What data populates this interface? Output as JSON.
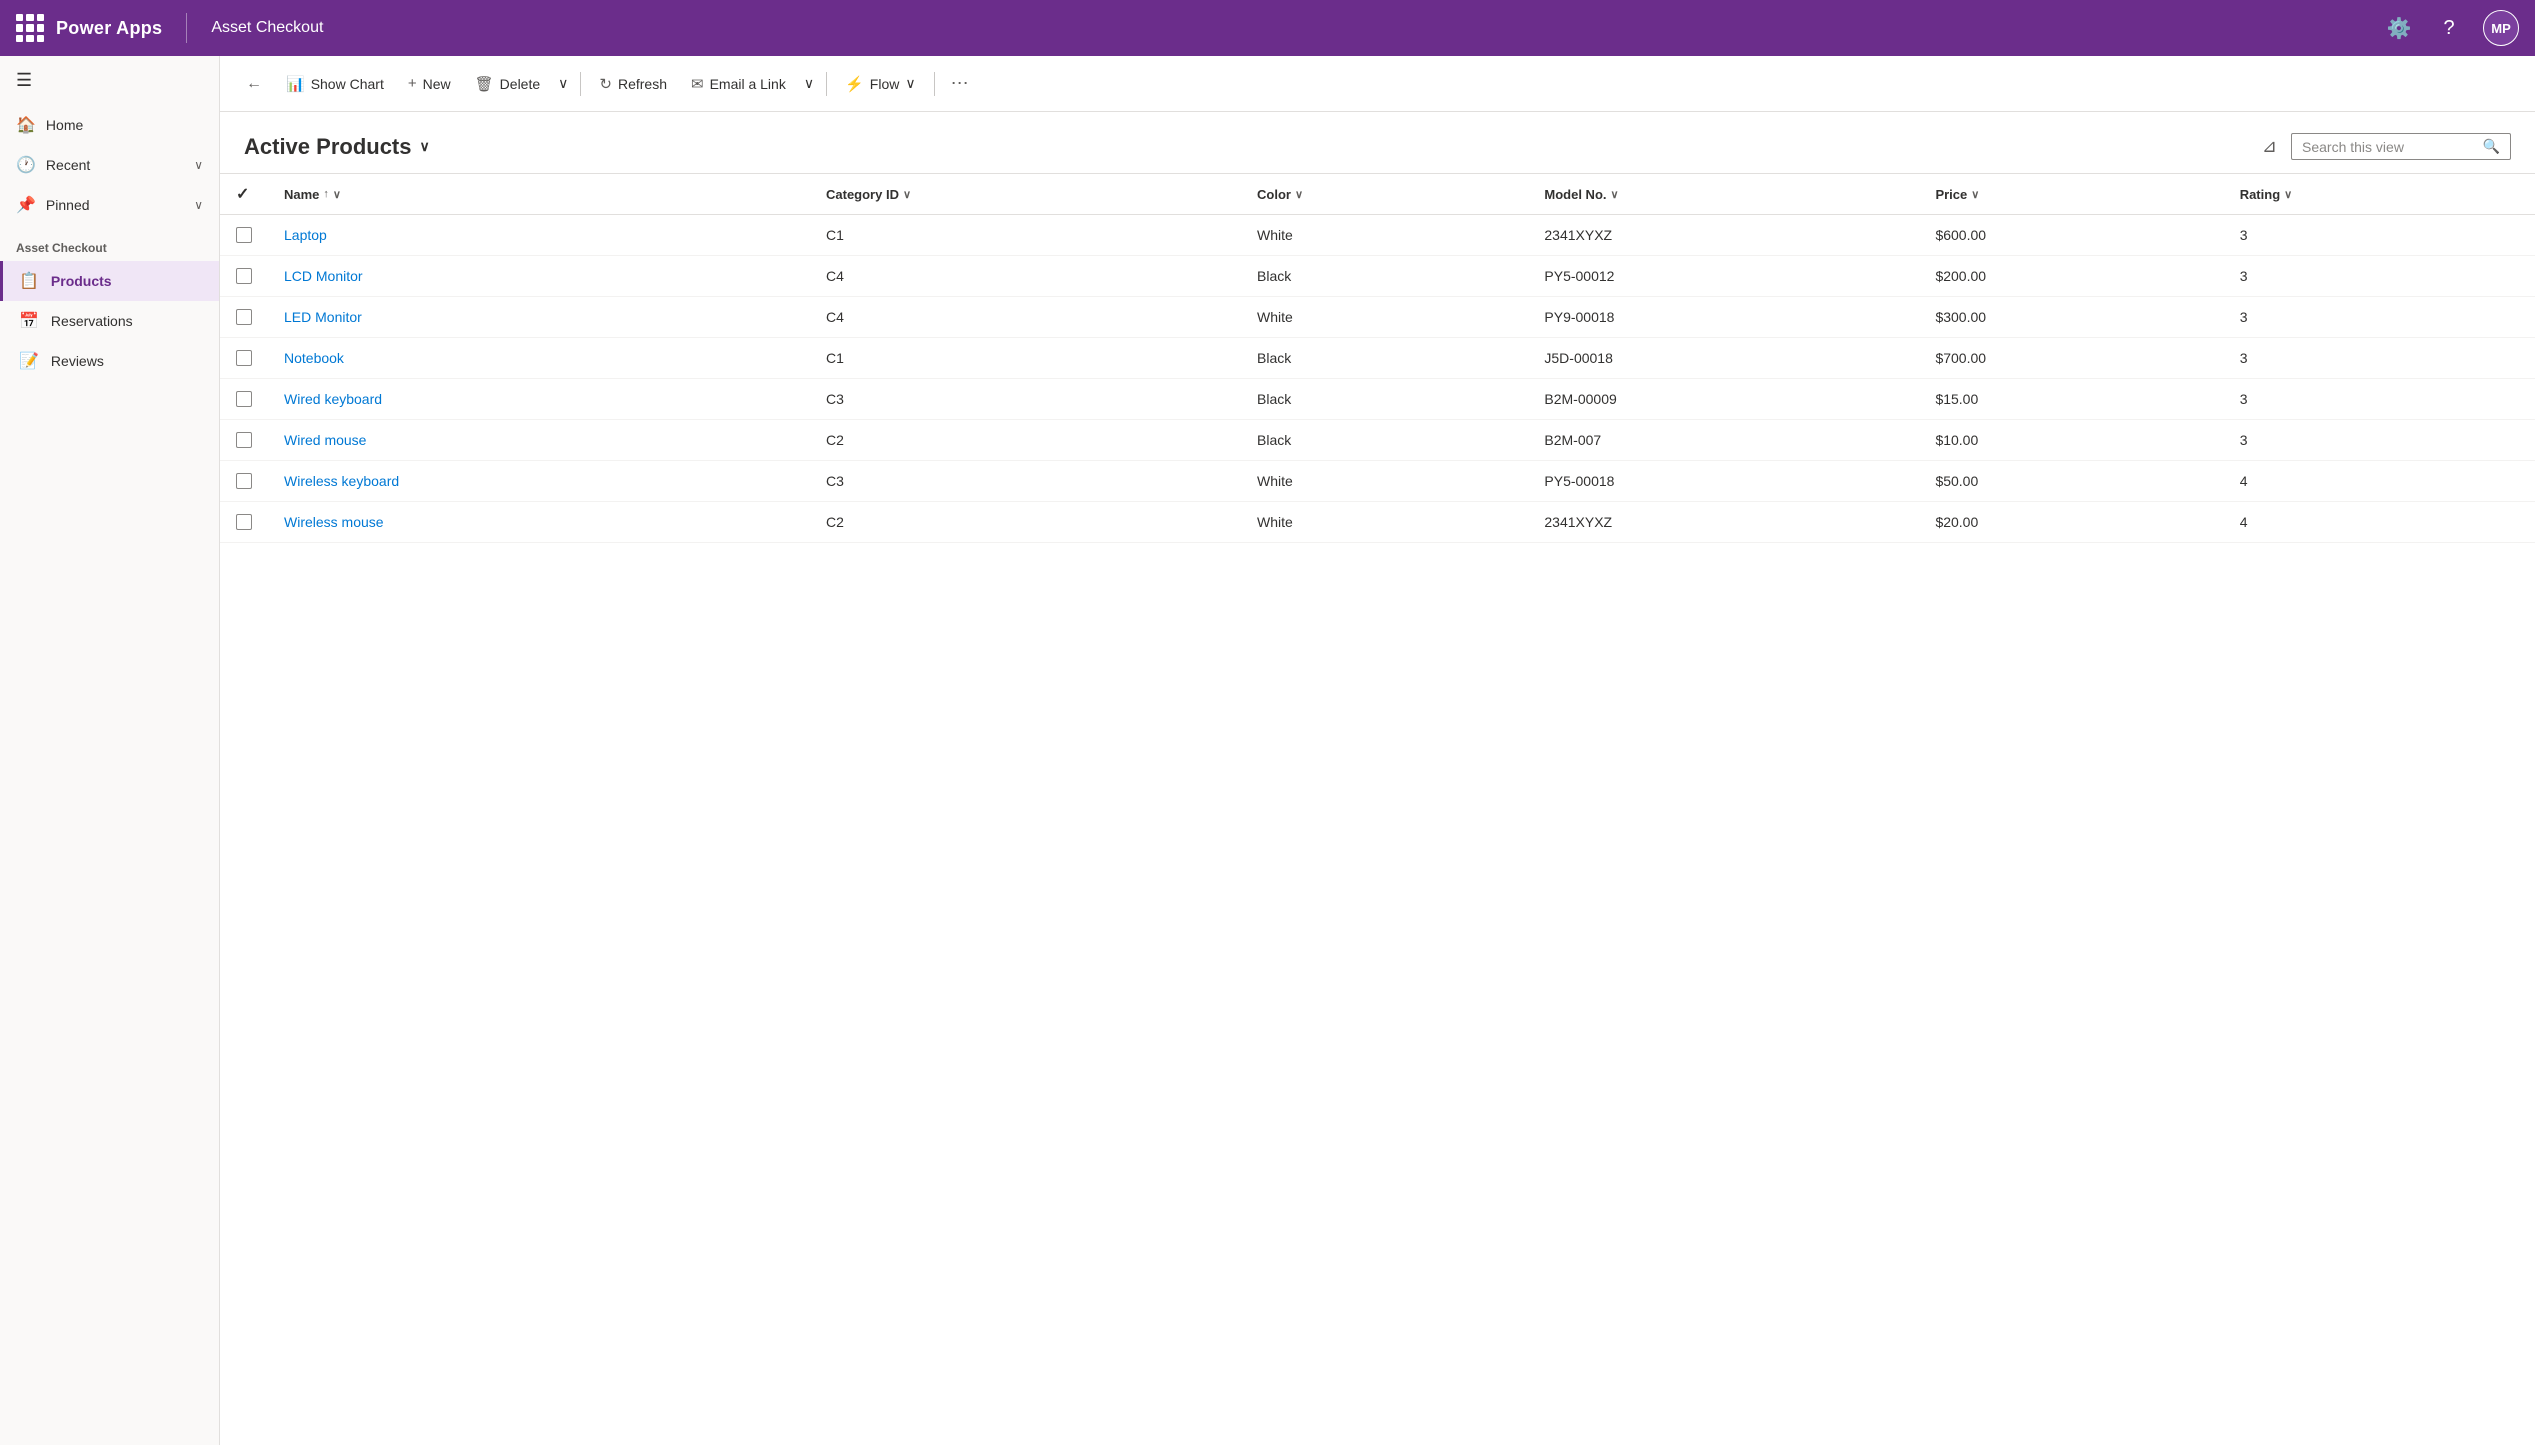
{
  "header": {
    "app_name": "Power Apps",
    "app_title": "Asset Checkout",
    "avatar_initials": "MP"
  },
  "toolbar": {
    "back_label": "Back",
    "show_chart_label": "Show Chart",
    "new_label": "New",
    "delete_label": "Delete",
    "refresh_label": "Refresh",
    "email_link_label": "Email a Link",
    "flow_label": "Flow",
    "more_label": "More"
  },
  "view": {
    "title": "Active Products",
    "search_placeholder": "Search this view"
  },
  "sidebar": {
    "nav_items": [
      {
        "id": "home",
        "label": "Home",
        "icon": "🏠"
      },
      {
        "id": "recent",
        "label": "Recent",
        "icon": "🕐",
        "hasChevron": true
      },
      {
        "id": "pinned",
        "label": "Pinned",
        "icon": "📌",
        "hasChevron": true
      }
    ],
    "section_title": "Asset Checkout",
    "app_items": [
      {
        "id": "products",
        "label": "Products",
        "icon": "📋",
        "active": true
      },
      {
        "id": "reservations",
        "label": "Reservations",
        "icon": "📅"
      },
      {
        "id": "reviews",
        "label": "Reviews",
        "icon": "📝"
      }
    ]
  },
  "table": {
    "columns": [
      {
        "id": "name",
        "label": "Name",
        "sortable": true,
        "sort_dir": "asc"
      },
      {
        "id": "category_id",
        "label": "Category ID",
        "sortable": true
      },
      {
        "id": "color",
        "label": "Color",
        "sortable": true
      },
      {
        "id": "model_no",
        "label": "Model No.",
        "sortable": true
      },
      {
        "id": "price",
        "label": "Price",
        "sortable": true
      },
      {
        "id": "rating",
        "label": "Rating",
        "sortable": true
      }
    ],
    "rows": [
      {
        "id": 1,
        "name": "Laptop",
        "category_id": "C1",
        "color": "White",
        "model_no": "2341XYXZ",
        "price": "$600.00",
        "rating": "3"
      },
      {
        "id": 2,
        "name": "LCD Monitor",
        "category_id": "C4",
        "color": "Black",
        "model_no": "PY5-00012",
        "price": "$200.00",
        "rating": "3"
      },
      {
        "id": 3,
        "name": "LED Monitor",
        "category_id": "C4",
        "color": "White",
        "model_no": "PY9-00018",
        "price": "$300.00",
        "rating": "3"
      },
      {
        "id": 4,
        "name": "Notebook",
        "category_id": "C1",
        "color": "Black",
        "model_no": "J5D-00018",
        "price": "$700.00",
        "rating": "3"
      },
      {
        "id": 5,
        "name": "Wired keyboard",
        "category_id": "C3",
        "color": "Black",
        "model_no": "B2M-00009",
        "price": "$15.00",
        "rating": "3"
      },
      {
        "id": 6,
        "name": "Wired mouse",
        "category_id": "C2",
        "color": "Black",
        "model_no": "B2M-007",
        "price": "$10.00",
        "rating": "3"
      },
      {
        "id": 7,
        "name": "Wireless keyboard",
        "category_id": "C3",
        "color": "White",
        "model_no": "PY5-00018",
        "price": "$50.00",
        "rating": "4"
      },
      {
        "id": 8,
        "name": "Wireless mouse",
        "category_id": "C2",
        "color": "White",
        "model_no": "2341XYXZ",
        "price": "$20.00",
        "rating": "4"
      }
    ]
  },
  "colors": {
    "brand_purple": "#6b2d8b",
    "link_blue": "#0078d4",
    "active_sidebar_bg": "#f0e6f6"
  }
}
